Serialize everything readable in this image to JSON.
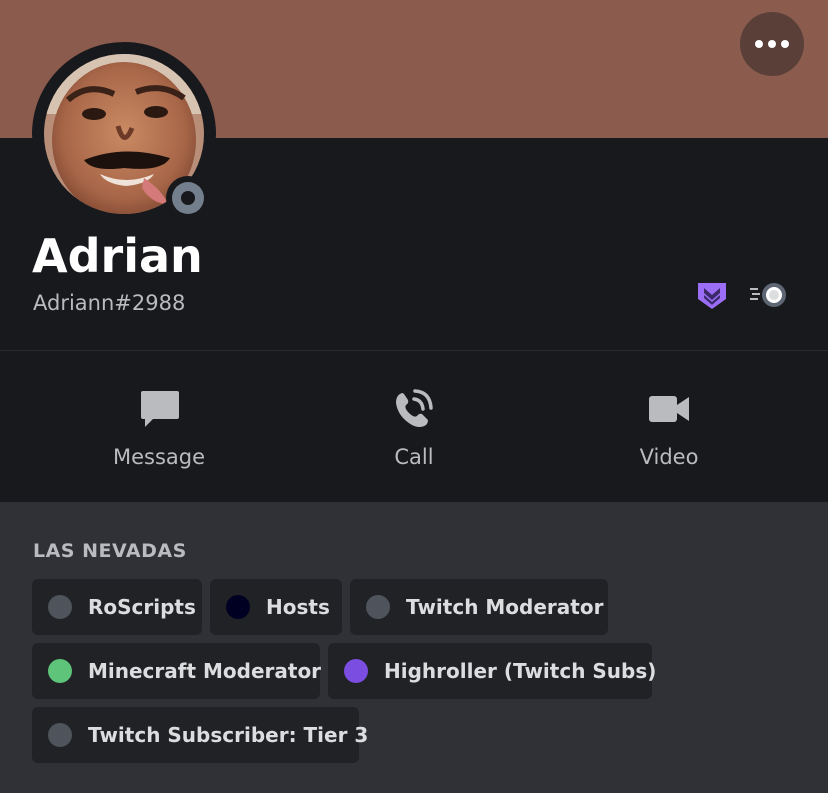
{
  "profile": {
    "display_name": "Adrian",
    "tag": "Adriann#2988",
    "status": "offline",
    "banner_color": "#8b5b4e",
    "badges": [
      "hypesquad-balance-icon",
      "nitro-boost-icon"
    ]
  },
  "actions": [
    {
      "label": "Message",
      "icon": "message-icon"
    },
    {
      "label": "Call",
      "icon": "phone-call-icon"
    },
    {
      "label": "Video",
      "icon": "video-camera-icon"
    }
  ],
  "roles_section": {
    "server_name": "LAS NEVADAS",
    "roles": [
      {
        "name": "RoScripts",
        "color": "#4f545c"
      },
      {
        "name": "Hosts",
        "color": "#000022"
      },
      {
        "name": "Twitch Moderator",
        "color": "#4f545c"
      },
      {
        "name": "Minecraft Moderator",
        "color": "#5ec47a"
      },
      {
        "name": "Highroller (Twitch Subs)",
        "color": "#7b4de0"
      },
      {
        "name": "Twitch Subscriber: Tier 3",
        "color": "#4f545c"
      }
    ]
  }
}
